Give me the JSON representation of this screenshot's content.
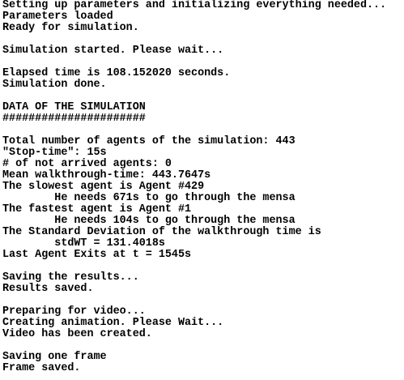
{
  "console": {
    "lines": [
      "Setting up parameters and initializing everything needed...",
      "Parameters loaded",
      "Ready for simulation.",
      "",
      "Simulation started. Please wait...",
      "",
      "Elapsed time is 108.152020 seconds.",
      "Simulation done.",
      "",
      "DATA OF THE SIMULATION",
      "######################",
      "",
      "Total number of agents of the simulation: 443",
      "\"Stop-time\": 15s",
      "# of not arrived agents: 0",
      "Mean walkthrough-time: 443.7647s",
      "The slowest agent is Agent #429",
      "        He needs 671s to go through the mensa",
      "The fastest agent is Agent #1",
      "        He needs 104s to go through the mensa",
      "The Standard Deviation of the walkthrough time is",
      "        stdWT = 131.4018s",
      "Last Agent Exits at t = 1545s",
      "",
      "Saving the results...",
      "Results saved.",
      "",
      "Preparing for video...",
      "Creating animation. Please Wait...",
      "Video has been created.",
      "",
      "Saving one frame",
      "Frame saved."
    ]
  }
}
